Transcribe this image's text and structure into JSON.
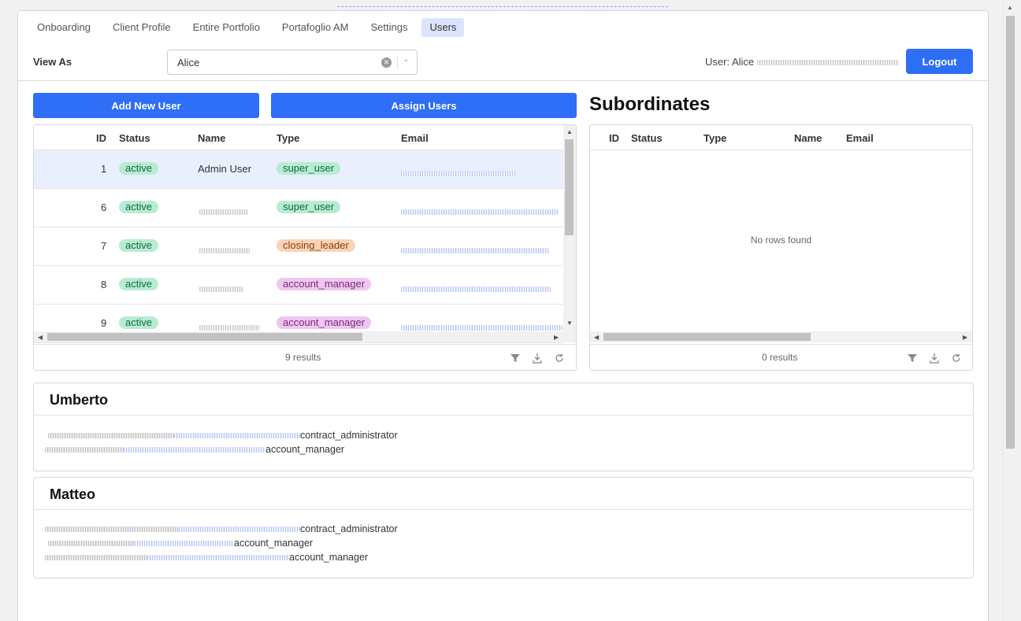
{
  "tabs": [
    "Onboarding",
    "Client Profile",
    "Entire Portfolio",
    "Portafoglio AM",
    "Settings",
    "Users"
  ],
  "active_tab": "Users",
  "view_as": {
    "label": "View As",
    "value": "Alice"
  },
  "user_label": "User: Alice",
  "logout_label": "Logout",
  "buttons": {
    "add_new_user": "Add New User",
    "assign_users": "Assign Users"
  },
  "subordinates_title": "Subordinates",
  "users_table": {
    "columns": [
      "ID",
      "Status",
      "Name",
      "Type",
      "Email"
    ],
    "rows": [
      {
        "id": "1",
        "status": "active",
        "name": "Admin User",
        "type": "super_user",
        "type_color": "green"
      },
      {
        "id": "6",
        "status": "active",
        "name": "",
        "type": "super_user",
        "type_color": "green"
      },
      {
        "id": "7",
        "status": "active",
        "name": "",
        "type": "closing_leader",
        "type_color": "orange"
      },
      {
        "id": "8",
        "status": "active",
        "name": "",
        "type": "account_manager",
        "type_color": "purple"
      },
      {
        "id": "9",
        "status": "active",
        "name": "",
        "type": "account_manager",
        "type_color": "purple"
      }
    ],
    "results": "9 results"
  },
  "subordinates_table": {
    "columns": [
      "ID",
      "Status",
      "Type",
      "Name",
      "Email"
    ],
    "empty_text": "No rows found",
    "results": "0 results"
  },
  "cards": [
    {
      "title": "Umberto",
      "lines": [
        "contract_administrator",
        "account_manager"
      ]
    },
    {
      "title": "Matteo",
      "lines": [
        "contract_administrator",
        "account_manager",
        "account_manager"
      ]
    }
  ],
  "colors": {
    "primary": "#2f6ef6",
    "active_tab_bg": "#dbe4fd",
    "badge_green": "#b8ecd2",
    "badge_orange": "#fbd3b7",
    "badge_purple": "#efc6ef"
  },
  "icons": [
    "clear-icon",
    "chevron-down-icon",
    "filter-icon",
    "download-icon",
    "refresh-icon"
  ]
}
